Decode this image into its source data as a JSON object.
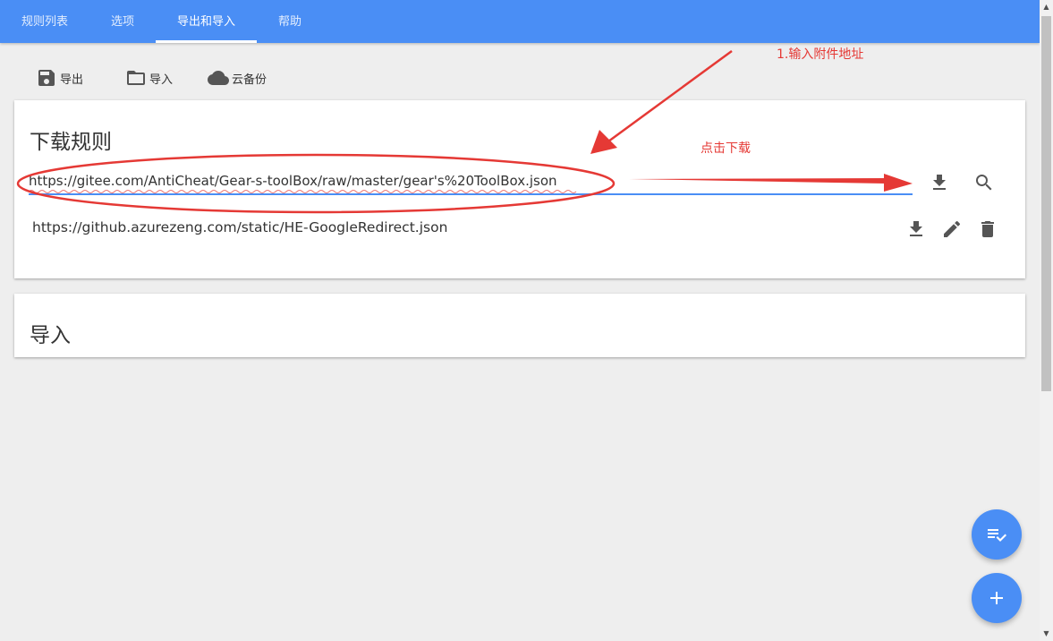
{
  "tabs": [
    {
      "label": "规则列表",
      "active": false
    },
    {
      "label": "选项",
      "active": false
    },
    {
      "label": "导出和导入",
      "active": true
    },
    {
      "label": "帮助",
      "active": false
    }
  ],
  "toolbar": {
    "export_label": "导出",
    "import_label": "导入",
    "cloud_label": "云备份"
  },
  "download_card": {
    "title": "下载规则",
    "url_value": "https://gitee.com/AntiCheat/Gear-s-toolBox/raw/master/gear's%20ToolBox.json",
    "rules": [
      {
        "url": "https://github.azurezeng.com/static/HE-GoogleRedirect.json"
      }
    ]
  },
  "import_card": {
    "title": "导入"
  },
  "annotations": {
    "step1": "1.输入附件地址",
    "click_download": "点击下载"
  },
  "colors": {
    "primary": "#4a8ef5",
    "annotation": "#e53935",
    "background": "#eeeeee"
  },
  "icons": [
    "save-icon",
    "folder-icon",
    "cloud-icon",
    "download-icon",
    "search-icon",
    "edit-icon",
    "delete-icon",
    "playlist-check-icon",
    "add-icon"
  ]
}
